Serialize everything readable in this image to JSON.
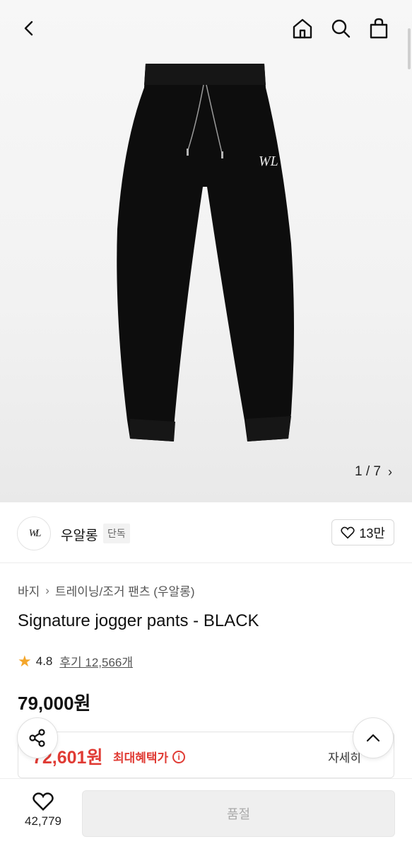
{
  "hero": {
    "pager_text": "1 / 7"
  },
  "brand": {
    "logo_text": "WL",
    "name": "우알롱",
    "badge": "단독",
    "like_count": "13만"
  },
  "product": {
    "breadcrumb": [
      "바지",
      "트레이닝/조거 팬츠 (우알롱)"
    ],
    "title": "Signature jogger pants - BLACK",
    "rating": "4.8",
    "reviews_label": "후기 12,566개",
    "price": "79,000원"
  },
  "best_price": {
    "price": "72,601원",
    "label": "최대혜택가",
    "detail": "자세히"
  },
  "bottom_bar": {
    "wish_count": "42,779",
    "buy_label": "품절"
  },
  "colors": {
    "accent_red": "#e03b34",
    "star": "#f4a62a"
  }
}
